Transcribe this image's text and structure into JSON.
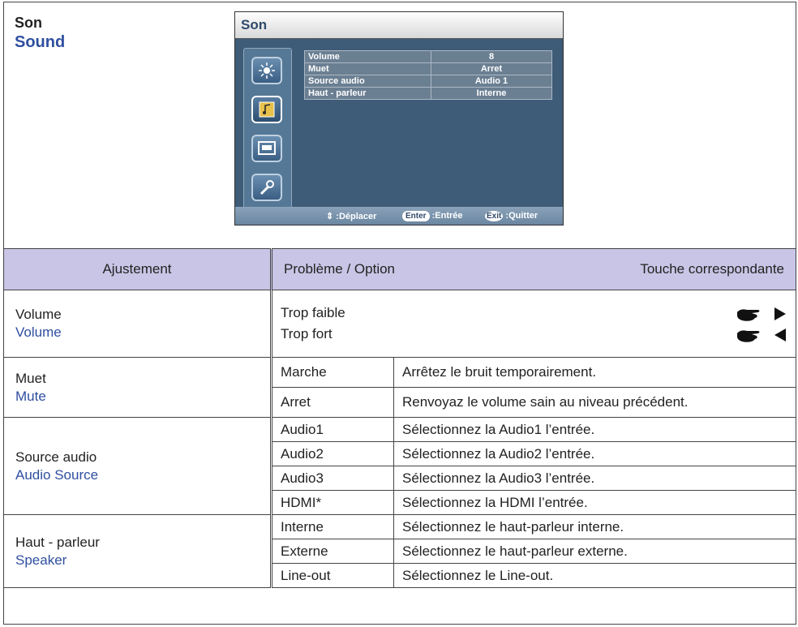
{
  "section": {
    "title_fr": "Son",
    "title_en": "Sound"
  },
  "osd": {
    "title": "Son",
    "rows": [
      {
        "label": "Volume",
        "value": "8"
      },
      {
        "label": "Muet",
        "value": "Arret"
      },
      {
        "label": "Source audio",
        "value": "Audio 1"
      },
      {
        "label": "Haut - parleur",
        "value": "Interne"
      }
    ],
    "footer": {
      "move": ":Déplacer",
      "enter_key": "Enter",
      "enter": ":Entrée",
      "exit_key": "Exit",
      "exit": ":Quitter"
    },
    "icons": [
      "brightness-icon",
      "sound-icon",
      "picture-icon",
      "setup-icon"
    ]
  },
  "table": {
    "headers": {
      "adjust": "Ajustement",
      "problem": "Problème / Option",
      "key": "Touche correspondante"
    },
    "volume": {
      "fr": "Volume",
      "en": "Volume",
      "opt1": "Trop faible",
      "opt2": "Trop fort"
    },
    "mute": {
      "fr": "Muet",
      "en": "Mute",
      "rows": [
        {
          "opt": "Marche",
          "desc": "Arrêtez le bruit temporairement."
        },
        {
          "opt": "Arret",
          "desc": "Renvoyaz le volume sain au niveau précédent."
        }
      ]
    },
    "source": {
      "fr": "Source audio",
      "en": "Audio Source",
      "rows": [
        {
          "opt": "Audio1",
          "desc": "Sélectionnez la Audio1 l’entrée."
        },
        {
          "opt": "Audio2",
          "desc": "Sélectionnez la Audio2 l’entrée."
        },
        {
          "opt": "Audio3",
          "desc": "Sélectionnez la Audio3 l’entrée."
        },
        {
          "opt": "HDMI*",
          "desc": "Sélectionnez la HDMI l’entrée."
        }
      ]
    },
    "speaker": {
      "fr": "Haut - parleur",
      "en": "Speaker",
      "rows": [
        {
          "opt": "Interne",
          "desc": "Sélectionnez le haut-parleur interne."
        },
        {
          "opt": "Externe",
          "desc": "Sélectionnez le haut-parleur externe."
        },
        {
          "opt": "Line-out",
          "desc": "Sélectionnez le Line-out."
        }
      ]
    }
  }
}
